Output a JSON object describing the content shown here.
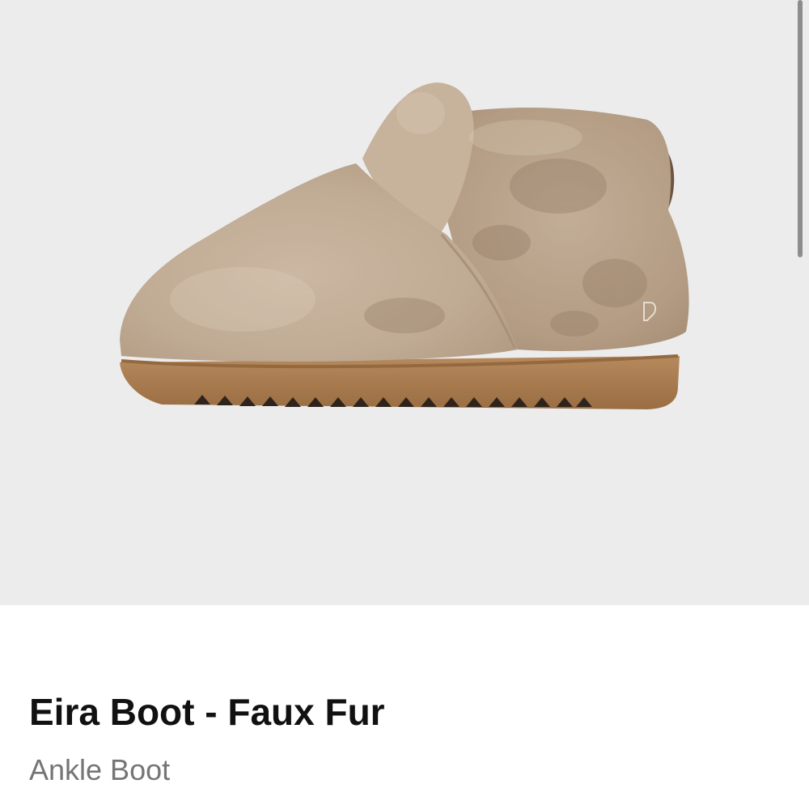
{
  "product": {
    "name": "Eira Boot - Faux Fur",
    "category": "Ankle Boot",
    "image_icon": "boot-product-photo"
  },
  "colors": {
    "image_background": "#ececed",
    "fur": "#c3ae98",
    "sole": "#a77a4e",
    "title_text": "#111111",
    "subtitle_text": "#757575"
  }
}
